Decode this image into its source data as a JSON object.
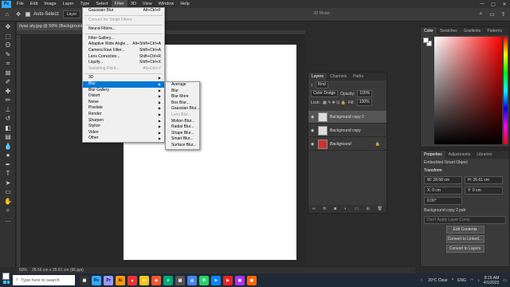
{
  "menubar": [
    "File",
    "Edit",
    "Image",
    "Layer",
    "Type",
    "Select",
    "Filter",
    "3D",
    "View",
    "Window",
    "Help"
  ],
  "options": {
    "auto_select": "Auto-Select:",
    "layer_dd": "Layer",
    "mode3d": "3D Mode:"
  },
  "doc_tab": "riyaz aly.jpg @ 50% (Background",
  "filter_menu": {
    "last": {
      "label": "Gaussian Blur",
      "shortcut": "Alt+Ctrl+F"
    },
    "convert": "Convert for Smart Filters",
    "neural": "Neural Filters...",
    "group2": [
      {
        "label": "Filter Gallery...",
        "shortcut": ""
      },
      {
        "label": "Adaptive Wide Angle...",
        "shortcut": "Alt+Shift+Ctrl+A"
      },
      {
        "label": "Camera Raw Filter...",
        "shortcut": "Shift+Ctrl+A"
      },
      {
        "label": "Lens Correction...",
        "shortcut": "Shift+Ctrl+R"
      },
      {
        "label": "Liquify...",
        "shortcut": "Shift+Ctrl+X"
      },
      {
        "label": "Vanishing Point...",
        "shortcut": "Alt+Ctrl+V"
      }
    ],
    "submenus": [
      "3D",
      "Blur",
      "Blur Gallery",
      "Distort",
      "Noise",
      "Pixelate",
      "Render",
      "Sharpen",
      "Stylize",
      "Video",
      "Other"
    ]
  },
  "blur_menu": [
    "Average",
    "Blur",
    "Blur More",
    "Box Blur...",
    "Gaussian Blur...",
    "Lens Blur...",
    "Motion Blur...",
    "Radial Blur...",
    "Shape Blur...",
    "Smart Blur...",
    "Surface Blur..."
  ],
  "color_panel": {
    "tabs": [
      "Color",
      "Swatches",
      "Gradients",
      "Patterns"
    ]
  },
  "layers_panel": {
    "tabs": [
      "Layers",
      "Channels",
      "Paths"
    ],
    "kind": "Kind",
    "blend": "Color Dodge",
    "opacity_label": "Opacity:",
    "opacity": "100%",
    "lock_label": "Lock:",
    "fill_label": "Fill:",
    "fill": "100%",
    "layers": [
      "Background copy 2",
      "Background copy",
      "Background"
    ]
  },
  "properties_panel": {
    "tabs": [
      "Properties",
      "Adjustments",
      "Libraries"
    ],
    "type": "Embedded Smart Object",
    "transform": "Transform",
    "w_label": "W:",
    "w": "28.58 cm",
    "h_label": "H:",
    "h": "35.61 cm",
    "x_label": "X:",
    "x": "0 cm",
    "y_label": "Y:",
    "y": "0 cm",
    "angle": "0.00°",
    "file": "Background copy 2.psb",
    "layer_comp": "Don't Apply Layer Comp",
    "buttons": [
      "Edit Contents",
      "Convert to Linked...",
      "Convert to Layers"
    ]
  },
  "status": {
    "zoom": "50%",
    "size": "28.56 cm x 35.61 cm (96 ppi)"
  },
  "taskbar": {
    "search": "Type here to search",
    "weather": "20°C Clear",
    "lang": "ENG",
    "time": "8:16 AM",
    "date": "4/1/2023"
  }
}
